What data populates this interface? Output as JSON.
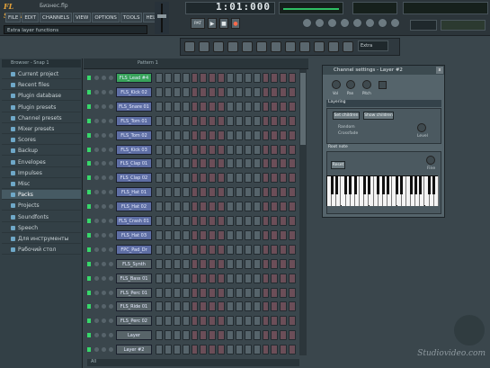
{
  "app": {
    "logo_text": "FL STUDIO",
    "file_name": "Бизнес.flp",
    "hint_text": "Extra layer functions",
    "time_display": "1:01:000"
  },
  "menu": [
    "FILE",
    "EDIT",
    "CHANNELS",
    "VIEW",
    "OPTIONS",
    "TOOLS",
    "HELP"
  ],
  "transport": {
    "play": "▶",
    "stop": "■",
    "record": "●",
    "pattern": "PAT"
  },
  "toolbar": {
    "pattern_value": "Extra"
  },
  "browser": {
    "title": "Browser - Snap 1",
    "items": [
      "Current project",
      "Recent files",
      "Plugin database",
      "Plugin presets",
      "Channel presets",
      "Mixer presets",
      "Scores",
      "Backup",
      "Envelopes",
      "Impulses",
      "Misc",
      "Packs",
      "Projects",
      "Soundfonts",
      "Speech",
      "Для инструменты",
      "Рабочий стол"
    ],
    "active_index": 11
  },
  "sequencer": {
    "title": "Pattern 1",
    "all_label": "All",
    "channels": [
      "FLS_Lead #4",
      "FLS_Kick 02",
      "FLS_Snare 01",
      "FLS_Tom 01",
      "FLS_Tom 02",
      "FLS_Kick 03",
      "FLS_Clap 01",
      "FLS_Clap 02",
      "FLS_Hat 01",
      "FLS_Hat 02",
      "FLS_Crash 01",
      "FLS_Hat 03",
      "FPC_Pad_Dr",
      "FLS_Synth",
      "FLS_Bass 01",
      "FLS_Perc 01",
      "FLS_Ride 01",
      "FLS_Perc 02",
      "Layer",
      "Layer #2"
    ],
    "green_index": 0,
    "grey_indices": [
      13,
      14,
      15,
      16,
      17,
      18,
      19
    ]
  },
  "channel_settings": {
    "title": "Channel settings - Layer #2",
    "close": "x",
    "knobs": [
      "Vol",
      "Pan",
      "Pitch"
    ],
    "tab_label": "Layering",
    "buttons": {
      "set_children": "Set children",
      "show_children": "Show children"
    },
    "options": [
      "Random",
      "Crossfade"
    ],
    "level_label": "Level",
    "piano_label": "Root note",
    "reset_label": "Reset",
    "fine_label": "Fine"
  },
  "watermark": "Studiovideo.com",
  "colors": {
    "accent_green": "#37d86a",
    "channel_blue": "#5e6ea4",
    "background": "#3a464c"
  }
}
